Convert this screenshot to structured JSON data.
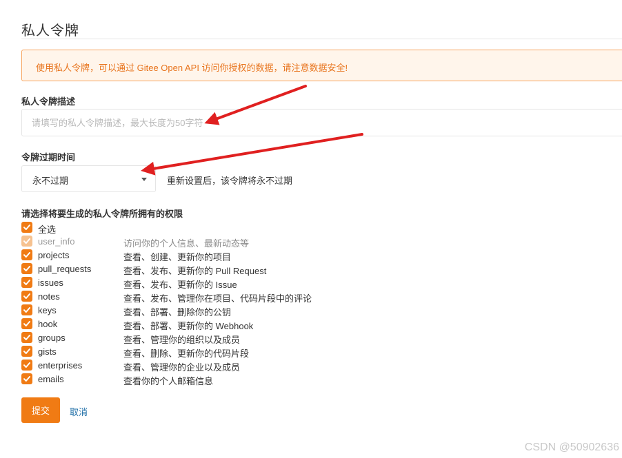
{
  "page": {
    "title": "私人令牌"
  },
  "notice": {
    "text": "使用私人令牌，可以通过 Gitee Open API 访问你授权的数据，请注意数据安全!",
    "color": "#e8741d",
    "background": "#fff5eb"
  },
  "description_field": {
    "label": "私人令牌描述",
    "placeholder": "请填写的私人令牌描述，最大长度为50字符",
    "value": ""
  },
  "expiry": {
    "label": "令牌过期时间",
    "selected": "永不过期",
    "hint": "重新设置后，该令牌将永不过期"
  },
  "permissions": {
    "label": "请选择将要生成的私人令牌所拥有的权限",
    "select_all": {
      "label": "全选",
      "checked": true
    },
    "items": [
      {
        "name": "user_info",
        "desc": "访问你的个人信息、最新动态等",
        "checked": true,
        "disabled": true
      },
      {
        "name": "projects",
        "desc": "查看、创建、更新你的项目",
        "checked": true,
        "disabled": false
      },
      {
        "name": "pull_requests",
        "desc": "查看、发布、更新你的 Pull Request",
        "checked": true,
        "disabled": false
      },
      {
        "name": "issues",
        "desc": "查看、发布、更新你的 Issue",
        "checked": true,
        "disabled": false
      },
      {
        "name": "notes",
        "desc": "查看、发布、管理你在项目、代码片段中的评论",
        "checked": true,
        "disabled": false
      },
      {
        "name": "keys",
        "desc": "查看、部署、删除你的公钥",
        "checked": true,
        "disabled": false
      },
      {
        "name": "hook",
        "desc": "查看、部署、更新你的 Webhook",
        "checked": true,
        "disabled": false
      },
      {
        "name": "groups",
        "desc": "查看、管理你的组织以及成员",
        "checked": true,
        "disabled": false
      },
      {
        "name": "gists",
        "desc": "查看、删除、更新你的代码片段",
        "checked": true,
        "disabled": false
      },
      {
        "name": "enterprises",
        "desc": "查看、管理你的企业以及成员",
        "checked": true,
        "disabled": false
      },
      {
        "name": "emails",
        "desc": "查看你的个人邮箱信息",
        "checked": true,
        "disabled": false
      }
    ]
  },
  "actions": {
    "submit_label": "提交",
    "cancel_label": "取消"
  },
  "colors": {
    "accent": "#f07b14",
    "link": "#1e6ea7",
    "annotation_arrow": "#e02020"
  },
  "watermark": "CSDN @50902636"
}
